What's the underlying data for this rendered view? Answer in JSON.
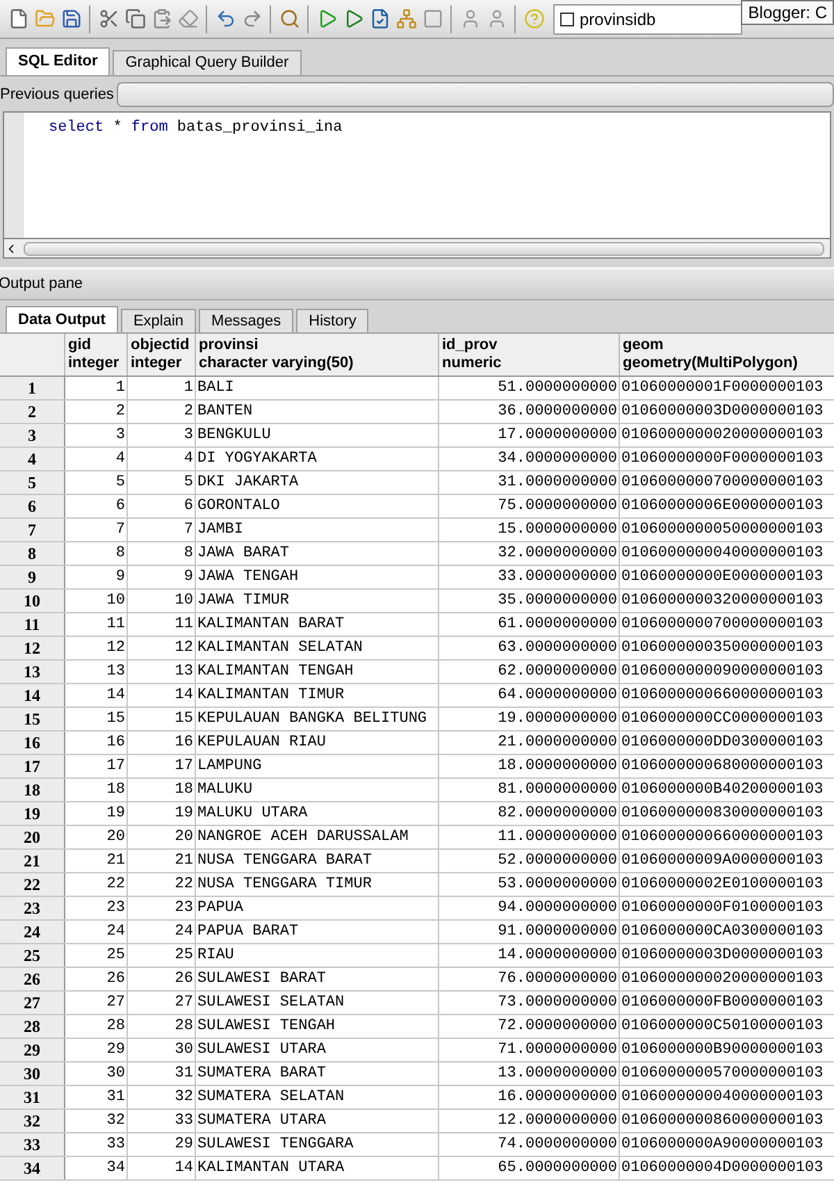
{
  "toolbar": {
    "connection": {
      "label": "provinsidb",
      "checked": false
    },
    "tooltip": "Blogger: C"
  },
  "editor_tabs": [
    {
      "label": "SQL Editor",
      "selected": true
    },
    {
      "label": "Graphical Query Builder",
      "selected": false
    }
  ],
  "previous_queries": {
    "label": "Previous queries"
  },
  "query": [
    {
      "text": "select",
      "kind": "keyword"
    },
    {
      "text": " * ",
      "kind": "plain"
    },
    {
      "text": "from",
      "kind": "keyword"
    },
    {
      "text": " batas_provinsi_ina",
      "kind": "plain"
    }
  ],
  "output_pane": {
    "title": "Output pane"
  },
  "output_tabs": [
    {
      "label": "Data Output",
      "selected": true
    },
    {
      "label": "Explain",
      "selected": false
    },
    {
      "label": "Messages",
      "selected": false
    },
    {
      "label": "History",
      "selected": false
    }
  ],
  "table": {
    "columns": [
      {
        "name": "gid",
        "type": "integer"
      },
      {
        "name": "objectid",
        "type": "integer"
      },
      {
        "name": "provinsi",
        "type": "character varying(50)"
      },
      {
        "name": "id_prov",
        "type": "numeric"
      },
      {
        "name": "geom",
        "type": "geometry(MultiPolygon)"
      }
    ],
    "rows": [
      {
        "number": "1",
        "cells": [
          "1",
          "1",
          "BALI",
          "51.0000000000",
          "01060000001F0000000103"
        ]
      },
      {
        "number": "2",
        "cells": [
          "2",
          "2",
          "BANTEN",
          "36.0000000000",
          "01060000003D0000000103"
        ]
      },
      {
        "number": "3",
        "cells": [
          "3",
          "3",
          "BENGKULU",
          "17.0000000000",
          "0106000000020000000103"
        ]
      },
      {
        "number": "4",
        "cells": [
          "4",
          "4",
          "DI YOGYAKARTA",
          "34.0000000000",
          "01060000000F0000000103"
        ]
      },
      {
        "number": "5",
        "cells": [
          "5",
          "5",
          "DKI JAKARTA",
          "31.0000000000",
          "0106000000700000000103"
        ]
      },
      {
        "number": "6",
        "cells": [
          "6",
          "6",
          "GORONTALO",
          "75.0000000000",
          "01060000006E0000000103"
        ]
      },
      {
        "number": "7",
        "cells": [
          "7",
          "7",
          "JAMBI",
          "15.0000000000",
          "0106000000050000000103"
        ]
      },
      {
        "number": "8",
        "cells": [
          "8",
          "8",
          "JAWA BARAT",
          "32.0000000000",
          "0106000000040000000103"
        ]
      },
      {
        "number": "9",
        "cells": [
          "9",
          "9",
          "JAWA TENGAH",
          "33.0000000000",
          "01060000000E0000000103"
        ]
      },
      {
        "number": "10",
        "cells": [
          "10",
          "10",
          "JAWA TIMUR",
          "35.0000000000",
          "0106000000320000000103"
        ]
      },
      {
        "number": "11",
        "cells": [
          "11",
          "11",
          "KALIMANTAN BARAT",
          "61.0000000000",
          "0106000000700000000103"
        ]
      },
      {
        "number": "12",
        "cells": [
          "12",
          "12",
          "KALIMANTAN SELATAN",
          "63.0000000000",
          "0106000000350000000103"
        ]
      },
      {
        "number": "13",
        "cells": [
          "13",
          "13",
          "KALIMANTAN TENGAH",
          "62.0000000000",
          "0106000000090000000103"
        ]
      },
      {
        "number": "14",
        "cells": [
          "14",
          "14",
          "KALIMANTAN TIMUR",
          "64.0000000000",
          "0106000000660000000103"
        ]
      },
      {
        "number": "15",
        "cells": [
          "15",
          "15",
          "KEPULAUAN BANGKA BELITUNG",
          "19.0000000000",
          "0106000000CC0000000103"
        ]
      },
      {
        "number": "16",
        "cells": [
          "16",
          "16",
          "KEPULAUAN RIAU",
          "21.0000000000",
          "0106000000DD0300000103"
        ]
      },
      {
        "number": "17",
        "cells": [
          "17",
          "17",
          "LAMPUNG",
          "18.0000000000",
          "0106000000680000000103"
        ]
      },
      {
        "number": "18",
        "cells": [
          "18",
          "18",
          "MALUKU",
          "81.0000000000",
          "0106000000B40200000103"
        ]
      },
      {
        "number": "19",
        "cells": [
          "19",
          "19",
          "MALUKU UTARA",
          "82.0000000000",
          "0106000000830000000103"
        ]
      },
      {
        "number": "20",
        "cells": [
          "20",
          "20",
          "NANGROE ACEH DARUSSALAM",
          "11.0000000000",
          "0106000000660000000103"
        ]
      },
      {
        "number": "21",
        "cells": [
          "21",
          "21",
          "NUSA TENGGARA BARAT",
          "52.0000000000",
          "01060000009A0000000103"
        ]
      },
      {
        "number": "22",
        "cells": [
          "22",
          "22",
          "NUSA TENGGARA TIMUR",
          "53.0000000000",
          "01060000002E0100000103"
        ]
      },
      {
        "number": "23",
        "cells": [
          "23",
          "23",
          "PAPUA",
          "94.0000000000",
          "01060000000F0100000103"
        ]
      },
      {
        "number": "24",
        "cells": [
          "24",
          "24",
          "PAPUA BARAT",
          "91.0000000000",
          "0106000000CA0300000103"
        ]
      },
      {
        "number": "25",
        "cells": [
          "25",
          "25",
          "RIAU",
          "14.0000000000",
          "01060000003D0000000103"
        ]
      },
      {
        "number": "26",
        "cells": [
          "26",
          "26",
          "SULAWESI BARAT",
          "76.0000000000",
          "0106000000020000000103"
        ]
      },
      {
        "number": "27",
        "cells": [
          "27",
          "27",
          "SULAWESI SELATAN",
          "73.0000000000",
          "0106000000FB0000000103"
        ]
      },
      {
        "number": "28",
        "cells": [
          "28",
          "28",
          "SULAWESI TENGAH",
          "72.0000000000",
          "0106000000C50100000103"
        ]
      },
      {
        "number": "29",
        "cells": [
          "29",
          "30",
          "SULAWESI UTARA",
          "71.0000000000",
          "0106000000B90000000103"
        ]
      },
      {
        "number": "30",
        "cells": [
          "30",
          "31",
          "SUMATERA BARAT",
          "13.0000000000",
          "0106000000570000000103"
        ]
      },
      {
        "number": "31",
        "cells": [
          "31",
          "32",
          "SUMATERA SELATAN",
          "16.0000000000",
          "0106000000040000000103"
        ]
      },
      {
        "number": "32",
        "cells": [
          "32",
          "33",
          "SUMATERA UTARA",
          "12.0000000000",
          "0106000000860000000103"
        ]
      },
      {
        "number": "33",
        "cells": [
          "33",
          "29",
          "SULAWESI TENGGARA",
          "74.0000000000",
          "0106000000A90000000103"
        ]
      },
      {
        "number": "34",
        "cells": [
          "34",
          "14",
          "KALIMANTAN UTARA",
          "65.0000000000",
          "01060000004D0000000103"
        ]
      }
    ]
  }
}
